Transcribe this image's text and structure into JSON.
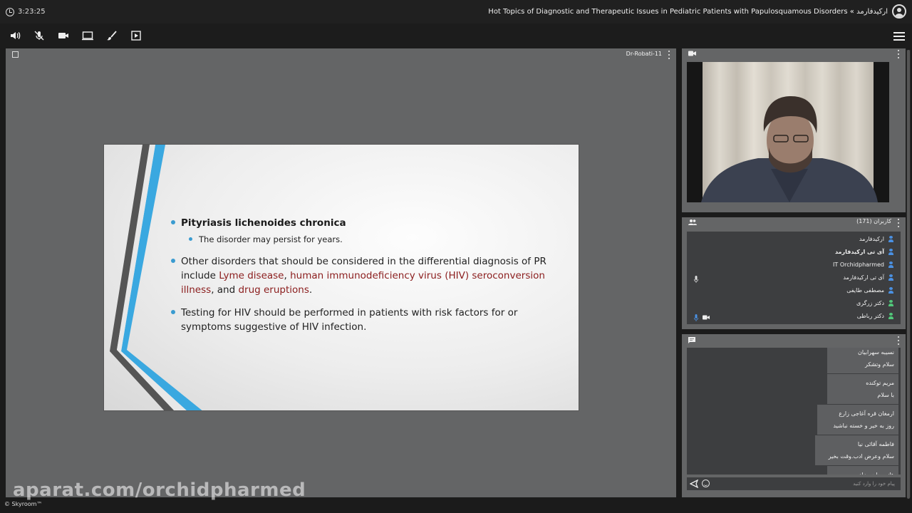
{
  "topbar": {
    "timer": "3:23:25",
    "title": "Hot Topics of Diagnostic and Therapeutic Issues in Pediatric Patients with Papulosquamous Disorders « ارکیدفارمد"
  },
  "toolbar": {
    "buttons": [
      "speaker-icon",
      "mic-muted-icon",
      "camera-icon",
      "screen-share-icon",
      "brush-icon",
      "presentation-icon"
    ],
    "menu": "hamburger-menu-icon"
  },
  "presentation": {
    "owner": "Dr-Robati-11",
    "slide": {
      "bullet1_title": "Pityriasis lichenoides chronica",
      "bullet1_sub": "The disorder may persist for years.",
      "bullet2_a": "Other disorders that should be considered in the differential diagnosis of PR include ",
      "bullet2_lyme": "Lyme disease",
      "bullet2_comma1": ", ",
      "bullet2_hiv": "human immunodeficiency virus (HIV) seroconversion illness",
      "bullet2_and": ", and ",
      "bullet2_drug": "drug eruptions",
      "bullet2_end": ".",
      "bullet3": "Testing for HIV should be performed in patients with risk factors for or symptoms suggestive of HIV infection."
    },
    "accent_color": "#3a9bd0",
    "highlight_color": "#8b1d1d"
  },
  "watermark": "aparat.com/orchidpharmed",
  "footer": "© Skyroom™",
  "users": {
    "title": "کاربران (171)",
    "list": [
      {
        "name": "ارکیدفارمد",
        "color": "blue",
        "bold": false
      },
      {
        "name": "آی تی ارکیدفارمد",
        "color": "blue",
        "bold": true
      },
      {
        "name": "IT Orchidpharmed",
        "color": "blue",
        "bold": false
      },
      {
        "name": "آی تی ارکیدفارمد",
        "color": "blue",
        "bold": false
      },
      {
        "name": "مصطفی طایفی",
        "color": "blue",
        "bold": false
      },
      {
        "name": "دکتر زرگری",
        "color": "green",
        "bold": false
      },
      {
        "name": "دکتر رباطی",
        "color": "green",
        "bold": false
      }
    ]
  },
  "chat": {
    "messages": [
      {
        "sender": "نسیبه سهرابیان",
        "text": "سلام وتشکر"
      },
      {
        "sender": "مریم توکنده",
        "text": "با سلام"
      },
      {
        "sender": "ارمغان قره آغاجی زارع",
        "text": "روز به خیر و خسته نباشید"
      },
      {
        "sender": "فاطمه آقائی نیا",
        "text": "سلام وعرض ادب.وقت بخیر"
      },
      {
        "sender": "هانیه حاجی زاده",
        "text": ""
      }
    ],
    "input_placeholder": "پیام خود را وارد کنید"
  }
}
